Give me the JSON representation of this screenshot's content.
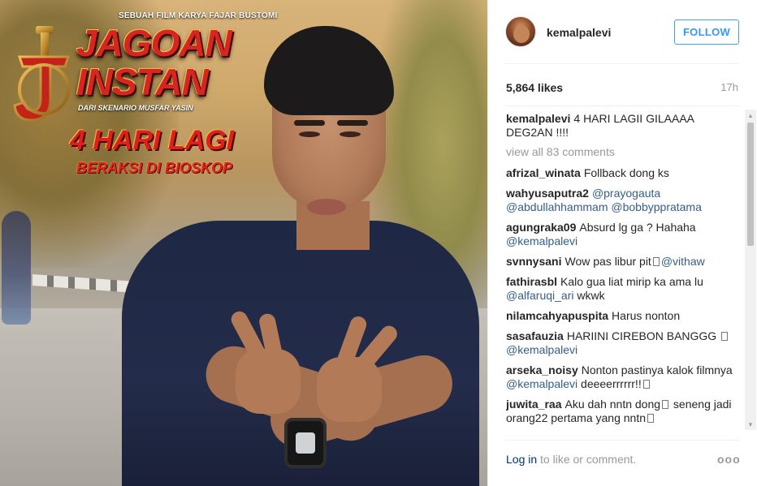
{
  "poster": {
    "credit": "SEBUAH FILM KARYA FAJAR BUSTOMI",
    "title_line1": "JAGOAN",
    "title_line2": "INSTAN",
    "script_credit": "DARI SKENARIO MUSFAR YASIN",
    "countdown": "4 HARI LAGI",
    "showing": "BERAKSI DI BIOSKOP"
  },
  "post": {
    "username": "kemalpalevi",
    "follow_label": "FOLLOW",
    "likes": "5,864 likes",
    "age": "17h",
    "caption": {
      "user": "kemalpalevi",
      "text": "4 HARI LAGII GILAAAA DEG2AN !!!!"
    },
    "view_all": "view all 83 comments",
    "comments": [
      {
        "user": "afrizal_winata",
        "text": "Follback dong ks"
      },
      {
        "user": "wahyusaputra2",
        "text": "",
        "mentions": "@prayogauta @abdullahhammam @bobbyppratama"
      },
      {
        "user": "agungraka09",
        "text": "Absurd lg ga ? Hahaha",
        "mentions": "@kemalpalevi"
      },
      {
        "user": "svnnysani",
        "text": "Wow pas libur pit",
        "mentions": "@vithaw"
      },
      {
        "user": "fathirasbl",
        "text": "Kalo gua liat mirip ka ama lu",
        "mentions": "@alfaruqi_ari",
        "text2": "wkwk"
      },
      {
        "user": "nilamcahyapuspita",
        "text": "Harus nonton"
      },
      {
        "user": "sasafauzia",
        "text": "HARIINI CIREBON BANGGG",
        "mentions": "@kemalpalevi"
      },
      {
        "user": "arseka_noisy",
        "text": "Nonton pastinya kalok filmnya",
        "mentions": "@kemalpalevi",
        "text2": "deeeerrrrrr!!"
      },
      {
        "user": "juwita_raa",
        "text": "Aku dah nntn dong",
        "text2": "seneng jadi orang22 pertama yang nntn"
      }
    ],
    "footer": {
      "login_link": "Log in",
      "login_text": "to like or comment.",
      "more": "ooo"
    }
  },
  "colors": {
    "follow_blue": "#3897f0",
    "mention": "#003569",
    "muted": "#999999",
    "poster_red": "#d7261f"
  }
}
